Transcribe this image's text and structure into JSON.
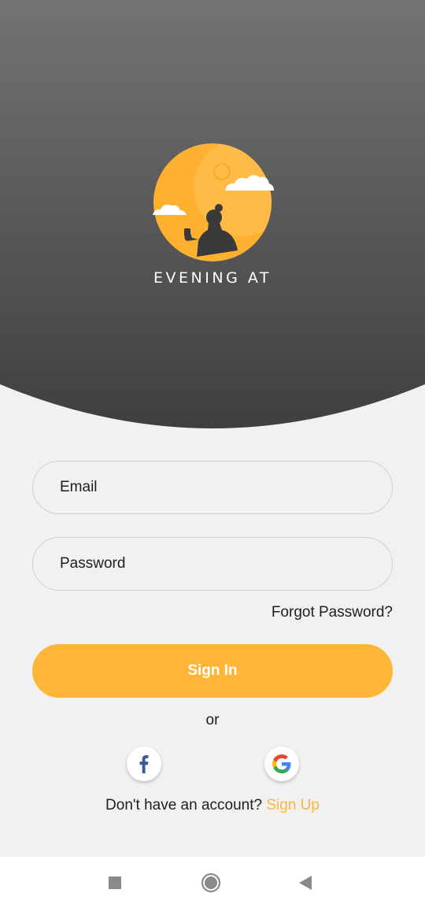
{
  "brand": {
    "name": "EVENING AT"
  },
  "colors": {
    "accent": "#ffb535",
    "header_top": "#737373",
    "header_bottom": "#3f3f3f",
    "background": "#f1f1f1"
  },
  "form": {
    "email": {
      "placeholder": "Email",
      "value": ""
    },
    "password": {
      "placeholder": "Password",
      "value": ""
    },
    "forgot_label": "Forgot Password?",
    "signin_label": "Sign In",
    "or_label": "or"
  },
  "social": {
    "facebook_icon": "facebook-icon",
    "google_icon": "google-icon"
  },
  "signup": {
    "prompt": "Don't have an account?",
    "link": "Sign Up"
  },
  "navbar": {
    "recent_icon": "square-icon",
    "home_icon": "circle-icon",
    "back_icon": "triangle-back-icon"
  }
}
